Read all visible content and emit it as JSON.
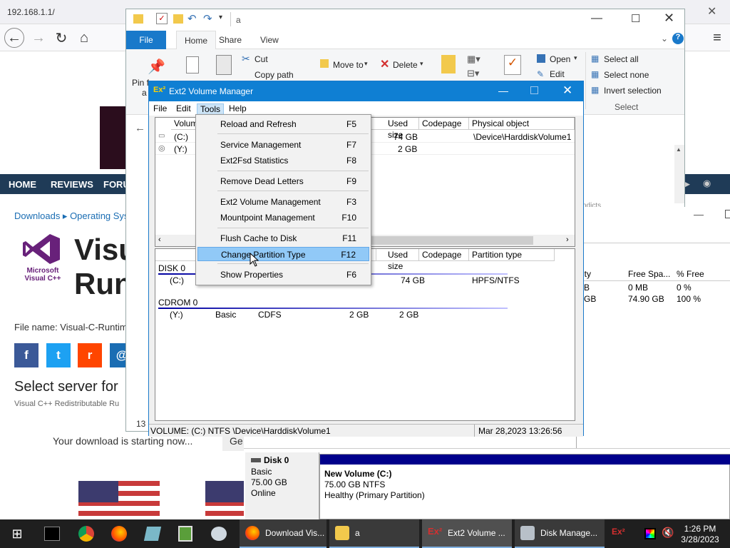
{
  "browser": {
    "url": "192.168.1.1/",
    "nav": [
      "HOME",
      "REVIEWS",
      "FORU"
    ],
    "breadcrumb": "Downloads  ▸  Operating Syst",
    "logo_text": "Microsoft Visual C++",
    "title_line1": "Visu",
    "title_line2": "Run",
    "filename": "File name: Visual-C-Runtim",
    "social": [
      "f",
      "t",
      "r",
      "@"
    ],
    "select_server": "Select server for",
    "redist": "Visual C++ Redistributable Ru",
    "dl_start": "Your download is starting now...",
    "get_fragment": "Ge",
    "page_number": "13"
  },
  "explorer": {
    "title": "a",
    "tabs": {
      "file": "File",
      "home": "Home",
      "share": "Share",
      "view": "View"
    },
    "ribbon": {
      "pin": "Pin f",
      "pin2": "a",
      "cut": "Cut",
      "copy_path": "Copy path",
      "move_to": "Move to",
      "delete": "Delete",
      "open": "Open",
      "edit": "Edit",
      "select_all": "Select all",
      "select_none": "Select none",
      "invert_selection": "Invert selection",
      "select_group": "Select"
    }
  },
  "diskmgmt": {
    "cols": [
      "ity",
      "Free Spa...",
      "% Free"
    ],
    "rows": [
      [
        "B",
        "0 MB",
        "0 %"
      ],
      [
        "GB",
        "74.90 GB",
        "100 %"
      ]
    ],
    "disk0": {
      "name": "Disk 0",
      "type": "Basic",
      "size": "75.00 GB",
      "status": "Online"
    },
    "volume": {
      "name": "New Volume  (C:)",
      "fs": "75.00 GB NTFS",
      "health": "Healthy (Primary Partition)"
    },
    "cut_text": "ndicts"
  },
  "ext2": {
    "title": "Ext2 Volume Manager",
    "menu": {
      "file": "File",
      "edit": "Edit",
      "tools": "Tools",
      "help": "Help"
    },
    "top_headers": [
      "Volum",
      "Used size",
      "Codepage",
      "Physical object"
    ],
    "top_rows": [
      {
        "vol": "(C:)",
        "used": "74 GB",
        "codepage": "",
        "phys": "\\Device\\HarddiskVolume1"
      },
      {
        "vol": "(Y:)",
        "used": "2 GB",
        "codepage": "",
        "phys": ""
      }
    ],
    "bottom_headers": [
      "Used size",
      "Codepage",
      "Partition type"
    ],
    "disk_label": "DISK 0",
    "disk_row": {
      "vol": "(C:)",
      "used": "74 GB",
      "ptype": "HPFS/NTFS"
    },
    "cdrom_label": "CDROM 0",
    "cdrom_row": {
      "vol": "(Y:)",
      "type": "Basic",
      "fs": "CDFS",
      "size": "2 GB",
      "used": "2 GB"
    },
    "status_left": "VOLUME: (C:) NTFS \\Device\\HarddiskVolume1",
    "status_right": "Mar 28,2023 13:26:56"
  },
  "tools_menu": [
    {
      "label": "Reload and Refresh",
      "shortcut": "F5"
    },
    {
      "label": "Service Management",
      "shortcut": "F7"
    },
    {
      "label": "Ext2Fsd Statistics",
      "shortcut": "F8"
    },
    {
      "label": "Remove Dead Letters",
      "shortcut": "F9"
    },
    {
      "label": "Ext2 Volume Management",
      "shortcut": "F3"
    },
    {
      "label": "Mountpoint Management",
      "shortcut": "F10"
    },
    {
      "label": "Flush Cache to Disk",
      "shortcut": "F11"
    },
    {
      "label": "Change Partition Type",
      "shortcut": "F12"
    },
    {
      "label": "Show Properties",
      "shortcut": "F6"
    }
  ],
  "taskbar": {
    "apps": [
      "Download Vis...",
      "a",
      "Ext2 Volume ...",
      "Disk Manage..."
    ],
    "time": "1:26 PM",
    "date": "3/28/2023"
  }
}
